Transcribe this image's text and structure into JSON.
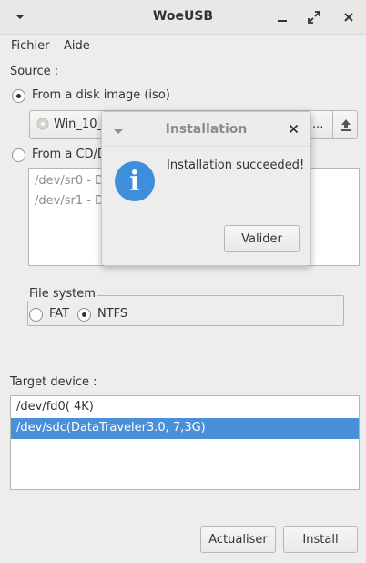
{
  "window": {
    "title": "WoeUSB"
  },
  "menu": {
    "items": [
      "Fichier",
      "Aide"
    ]
  },
  "source": {
    "label": "Source :",
    "disk_image_label": "From a disk image (iso)",
    "iso_file": "Win_10_1",
    "iso_file_tail": "...",
    "cdrom_label": "From a CD/D",
    "cd_devices": [
      "/dev/sr0 - D",
      "/dev/sr1 - D"
    ]
  },
  "filesystem": {
    "label": "File system",
    "options": [
      "FAT",
      "NTFS"
    ],
    "selected": "NTFS"
  },
  "target": {
    "label": "Target device :",
    "devices": [
      "/dev/fd0(  4K)",
      "/dev/sdc(DataTraveler3.0,  7,3G)"
    ],
    "selected_index": 1
  },
  "buttons": {
    "refresh": "Actualiser",
    "install": "Install"
  },
  "dialog": {
    "title": "Installation",
    "message": "Installation succeeded!",
    "ok": "Valider",
    "icon": "info-icon"
  },
  "colors": {
    "selection": "#4a90d9",
    "info": "#3d8fdc"
  }
}
